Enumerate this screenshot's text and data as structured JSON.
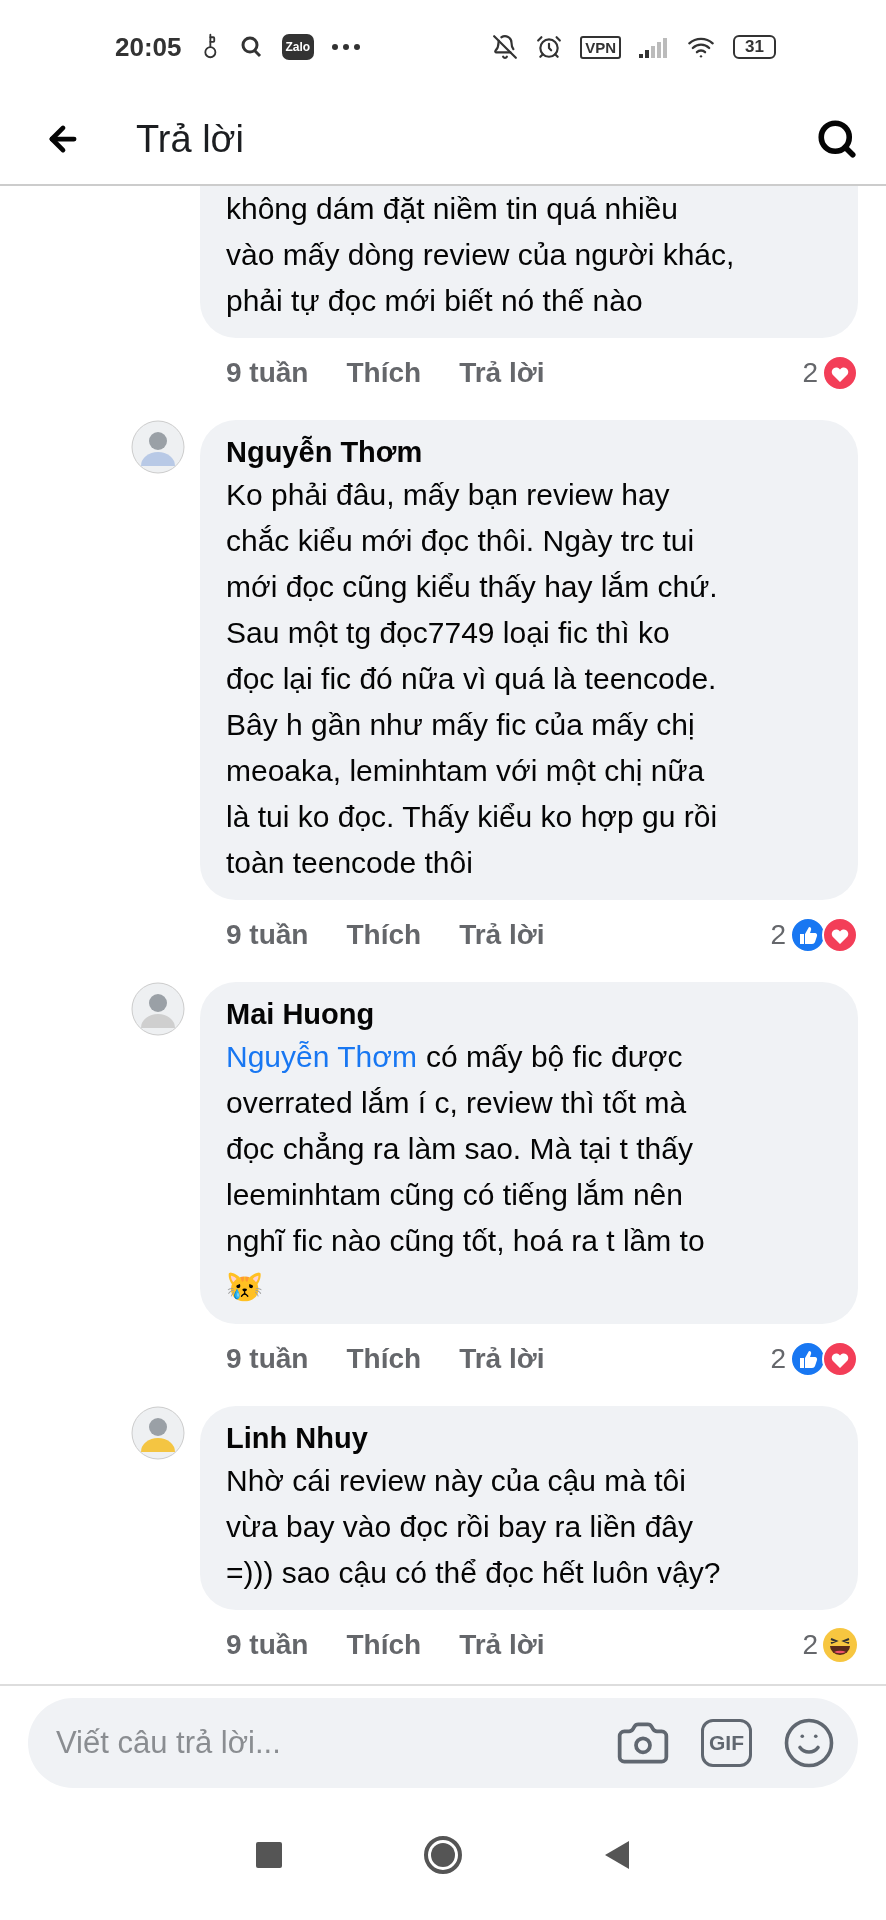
{
  "status_bar": {
    "time": "20:05",
    "app_badge": "Zalo",
    "vpn": "VPN",
    "battery": "31"
  },
  "header": {
    "title": "Trả lời"
  },
  "comments": [
    {
      "lines": [
        "không dám đặt niềm tin quá nhiều",
        "vào mấy dòng review của người khác,",
        "phải tự đọc mới biết nó thế nào"
      ],
      "age": "9 tuần",
      "like": "Thích",
      "reply": "Trả lời",
      "reaction_count": "2",
      "reactions": [
        {
          "kind": "love"
        }
      ]
    },
    {
      "author": "Nguyễn Thơm",
      "lines": [
        "Ko phải đâu, mấy bạn review hay",
        "chắc kiểu mới đọc thôi. Ngày trc tui",
        "mới đọc cũng kiểu thấy hay lắm chứ.",
        "Sau một tg đọc7749 loại fic thì ko",
        "đọc lại fic đó nữa vì quá là teencode.",
        "Bây h gần như mấy fic của mấy chị",
        "meoaka, leminhtam với một chị nữa",
        "là tui ko đọc. Thấy kiểu ko hợp gu rồi",
        "toàn teencode thôi"
      ],
      "age": "9 tuần",
      "like": "Thích",
      "reply": "Trả lời",
      "reaction_count": "2",
      "reactions": [
        {
          "kind": "like"
        },
        {
          "kind": "love"
        }
      ]
    },
    {
      "author": "Mai Huong",
      "mention": "Nguyễn Thơm",
      "lines": [
        "có mấy bộ fic được",
        "overrated lắm í c, review thì tốt mà",
        "đọc chẳng ra làm sao. Mà tại t thấy",
        "leeminhtam cũng có tiếng lắm nên",
        "nghĩ fic nào cũng tốt, hoá ra t lầm to",
        "😿"
      ],
      "age": "9 tuần",
      "like": "Thích",
      "reply": "Trả lời",
      "reaction_count": "2",
      "reactions": [
        {
          "kind": "like"
        },
        {
          "kind": "love"
        }
      ]
    },
    {
      "author": "Linh Nhuy",
      "lines": [
        "Nhờ cái review này của cậu mà tôi",
        "vừa bay vào đọc rồi bay ra liền đây",
        "=))) sao cậu có thể đọc hết luôn vậy?"
      ],
      "age": "9 tuần",
      "like": "Thích",
      "reply": "Trả lời",
      "reaction_count": "2",
      "reactions": [
        {
          "kind": "haha"
        }
      ]
    }
  ],
  "composer": {
    "placeholder": "Viết câu trả lời...",
    "gif": "GIF"
  }
}
